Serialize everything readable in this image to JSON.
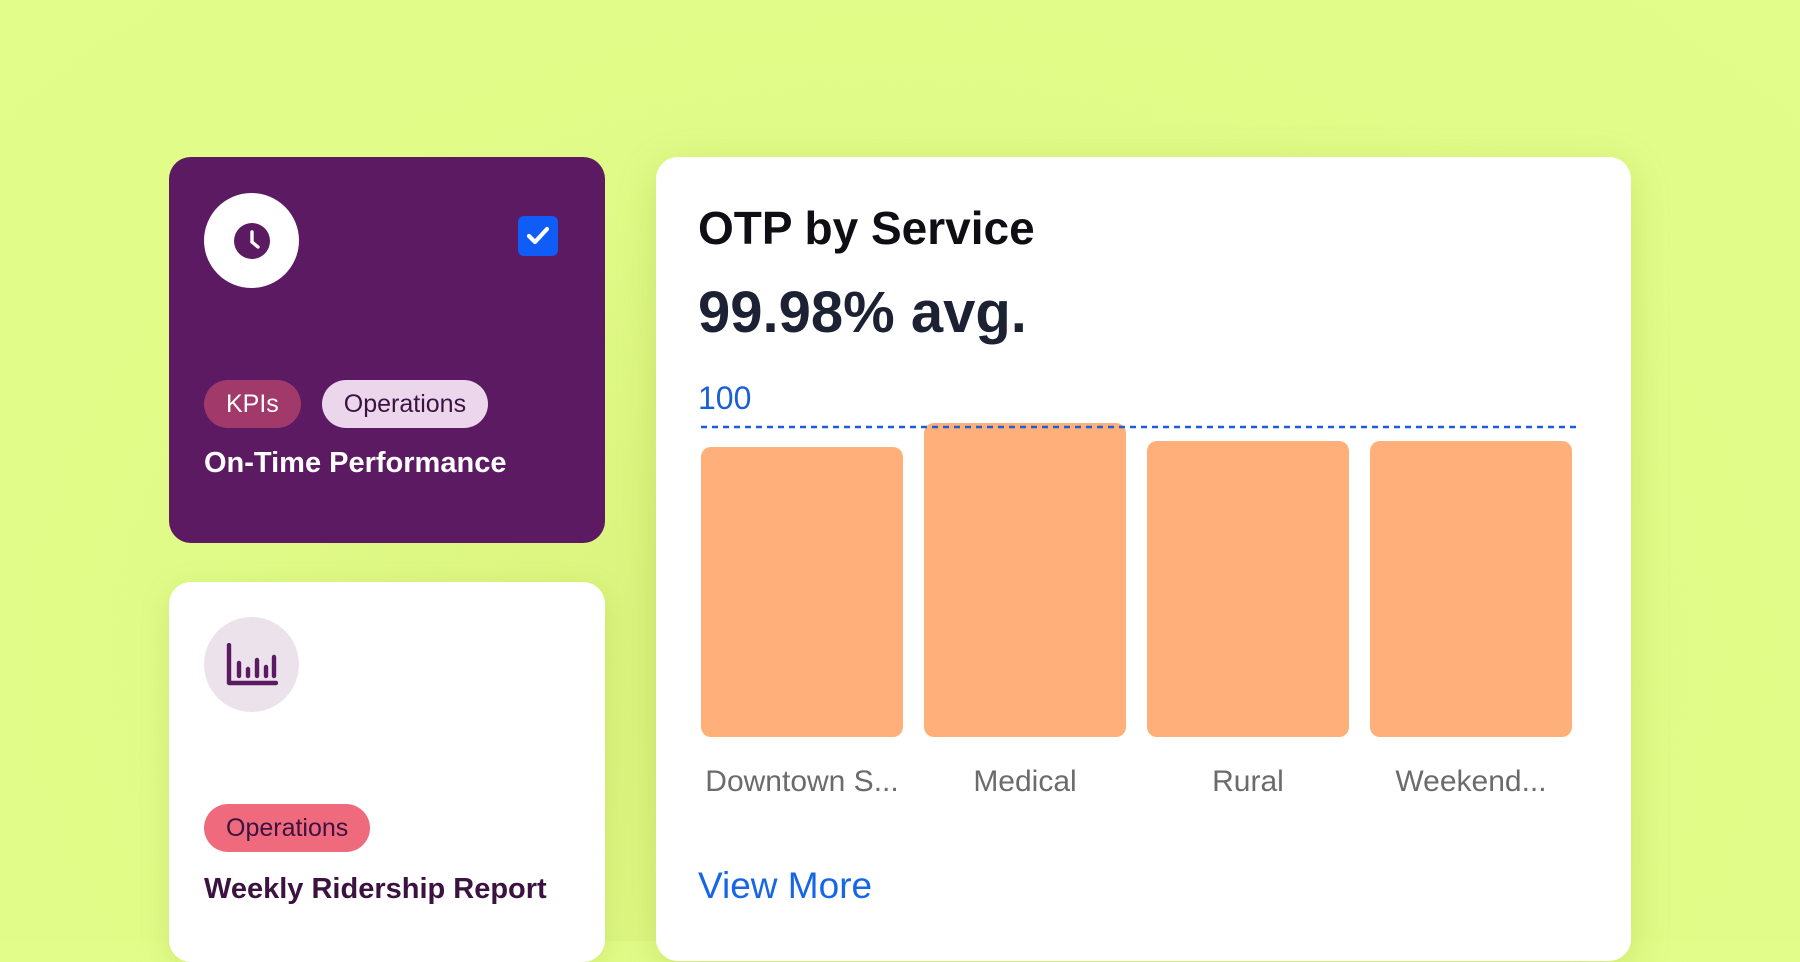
{
  "cards": [
    {
      "icon": "clock-icon",
      "checked": true,
      "tags": [
        "KPIs",
        "Operations"
      ],
      "title": "On-Time Performance",
      "colors": {
        "background": "#5c1a62",
        "tag_kpis": "#a13a6b",
        "tag_operations": "#ecd6ec"
      }
    },
    {
      "icon": "bar-chart-icon",
      "tags": [
        "Operations"
      ],
      "title": "Weekly Ridership Report",
      "colors": {
        "background": "#ffffff",
        "tag_operations": "#ee6a7c"
      }
    }
  ],
  "chart_panel": {
    "title": "OTP by Service",
    "metric": "99.98% avg.",
    "link": "View More"
  },
  "chart_data": {
    "type": "bar",
    "categories": [
      "Downtown S...",
      "Medical",
      "Rural",
      "Weekend..."
    ],
    "values": [
      99.97,
      100.01,
      99.98,
      99.98
    ],
    "reference_line": {
      "value": 100,
      "label": "100",
      "style": "dashed",
      "color": "#1a5fd6"
    },
    "bar_color": "#ffb07a",
    "grid": false,
    "legend": "none"
  },
  "colors": {
    "page_background": "#e1fb88",
    "link": "#1666e6",
    "checkbox": "#0f5cf6"
  }
}
